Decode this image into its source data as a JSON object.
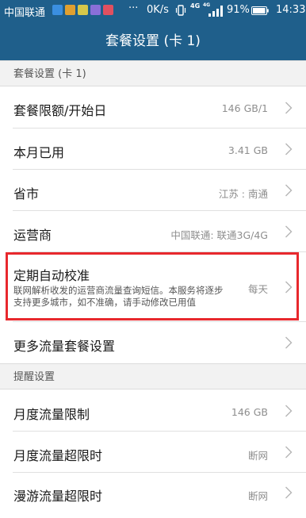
{
  "status_bar": {
    "carrier": "中国联通",
    "more": "···",
    "speed": "0K/s",
    "net_type": "4G",
    "net_type_small": "4G",
    "battery_percent": "91%",
    "time": "14:33",
    "app_icon_colors": [
      "#3b8fe0",
      "#e0a030",
      "#d6c84a",
      "#8a6fd8",
      "#e05060"
    ]
  },
  "app_bar": {
    "title": "套餐设置 (卡 1)"
  },
  "sections": {
    "plan_header": "套餐设置 (卡 1)",
    "reminder_header": "提醒设置"
  },
  "rows": {
    "plan_limit": {
      "title": "套餐限额/开始日",
      "value": "146 GB/1"
    },
    "used_this_month": {
      "title": "本月已用",
      "value": "3.41 GB"
    },
    "province_city": {
      "title": "省市",
      "value": "江苏 : 南通"
    },
    "operator": {
      "title": "运营商",
      "value": "中国联通: 联通3G/4G"
    },
    "auto_calibration": {
      "title": "定期自动校准",
      "description": "联网解析收发的运营商流量查询短信。本服务将逐步支持更多城市，如不准确，请手动修改已用值",
      "value": "每天"
    },
    "more_plan_settings": {
      "title": "更多流量套餐设置"
    },
    "monthly_limit": {
      "title": "月度流量限制",
      "value": "146 GB"
    },
    "monthly_over_limit": {
      "title": "月度流量超限时",
      "value": "断网"
    },
    "roaming_over_limit": {
      "title": "漫游流量超限时",
      "value": "断网"
    }
  },
  "colors": {
    "primary": "#1f5f8b",
    "highlight": "#e8282d"
  }
}
